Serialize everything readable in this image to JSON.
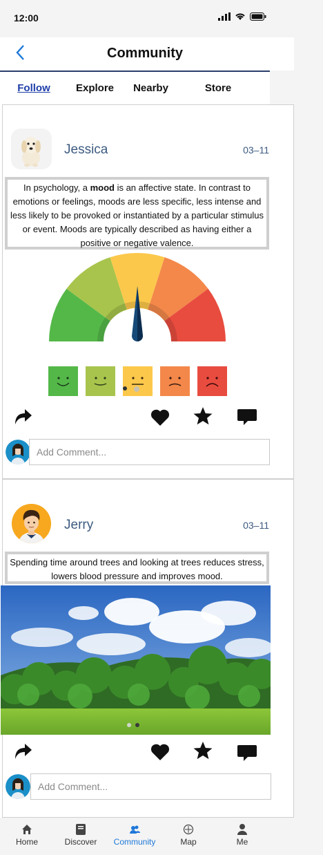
{
  "status_bar": {
    "time": "12:00"
  },
  "header": {
    "title": "Community"
  },
  "tabs": [
    {
      "label": "Follow",
      "active": true
    },
    {
      "label": "Explore",
      "active": false
    },
    {
      "label": "Nearby",
      "active": false
    },
    {
      "label": "Store",
      "active": false
    }
  ],
  "posts": [
    {
      "user": "Jessica",
      "date": "03–11",
      "text_before": "In psychology, a ",
      "text_bold": "mood",
      "text_after": " is an affective state. In contrast to emotions or feelings, moods are less specific, less intense and less likely to be provoked or instantiated by a particular stimulus or event. Moods are typically described as having either a positive or negative valence.",
      "image": "mood-gauge",
      "comment_placeholder": "Add Comment..."
    },
    {
      "user": "Jerry",
      "date": "03–11",
      "text": "Spending time around trees and looking at trees reduces stress, lowers blood pressure and improves mood.",
      "image": "forest-landscape",
      "comment_placeholder": "Add Comment..."
    }
  ],
  "bottom_nav": [
    {
      "label": "Home",
      "icon": "home-icon",
      "active": false
    },
    {
      "label": "Discover",
      "icon": "book-icon",
      "active": false
    },
    {
      "label": "Community",
      "icon": "people-icon",
      "active": true
    },
    {
      "label": "Map",
      "icon": "compass-icon",
      "active": false
    },
    {
      "label": "Me",
      "icon": "person-icon",
      "active": false
    }
  ],
  "colors": {
    "accent": "#1e78d8",
    "username": "#3c5a80",
    "tab_active": "#1e3da8"
  }
}
